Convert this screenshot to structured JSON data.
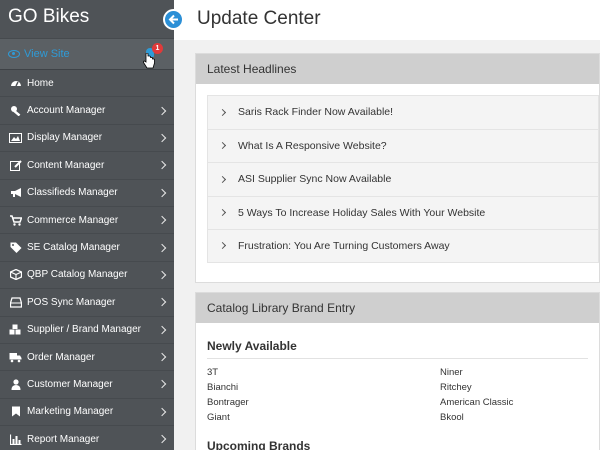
{
  "app": {
    "brand": "GO Bikes",
    "page_title": "Update Center"
  },
  "view_site": {
    "label": "View Site",
    "notification_count": "1"
  },
  "sidebar": {
    "items": [
      {
        "label": "Home",
        "icon": "dashboard-icon"
      },
      {
        "label": "Account Manager",
        "icon": "wrench-icon"
      },
      {
        "label": "Display Manager",
        "icon": "image-icon"
      },
      {
        "label": "Content Manager",
        "icon": "edit-icon"
      },
      {
        "label": "Classifieds Manager",
        "icon": "bullhorn-icon"
      },
      {
        "label": "Commerce Manager",
        "icon": "cart-icon"
      },
      {
        "label": "SE Catalog Manager",
        "icon": "tag-icon"
      },
      {
        "label": "QBP Catalog Manager",
        "icon": "cube-icon"
      },
      {
        "label": "POS Sync Manager",
        "icon": "hdd-icon"
      },
      {
        "label": "Supplier / Brand Manager",
        "icon": "cubes-icon"
      },
      {
        "label": "Order Manager",
        "icon": "truck-icon"
      },
      {
        "label": "Customer Manager",
        "icon": "user-icon"
      },
      {
        "label": "Marketing Manager",
        "icon": "bookmark-icon"
      },
      {
        "label": "Report Manager",
        "icon": "bar-chart-icon"
      }
    ]
  },
  "headlines": {
    "title": "Latest Headlines",
    "items": [
      "Saris Rack Finder Now Available!",
      "What Is A Responsive Website?",
      "ASI Supplier Sync Now Available",
      "5 Ways To Increase Holiday Sales With Your Website",
      "Frustration: You Are Turning Customers Away"
    ]
  },
  "catalog": {
    "title": "Catalog Library Brand Entry",
    "newly_available_title": "Newly Available",
    "brands": [
      "3T",
      "Niner",
      "Bianchi",
      "Ritchey",
      "Bontrager",
      "American Classic",
      "Giant",
      "Bkool"
    ],
    "upcoming_title": "Upcoming Brands"
  },
  "colors": {
    "sidebar_bg": "#4f5357",
    "accent": "#2f9bd7",
    "badge": "#e03a3a",
    "panel_head": "#cfcfcf"
  }
}
